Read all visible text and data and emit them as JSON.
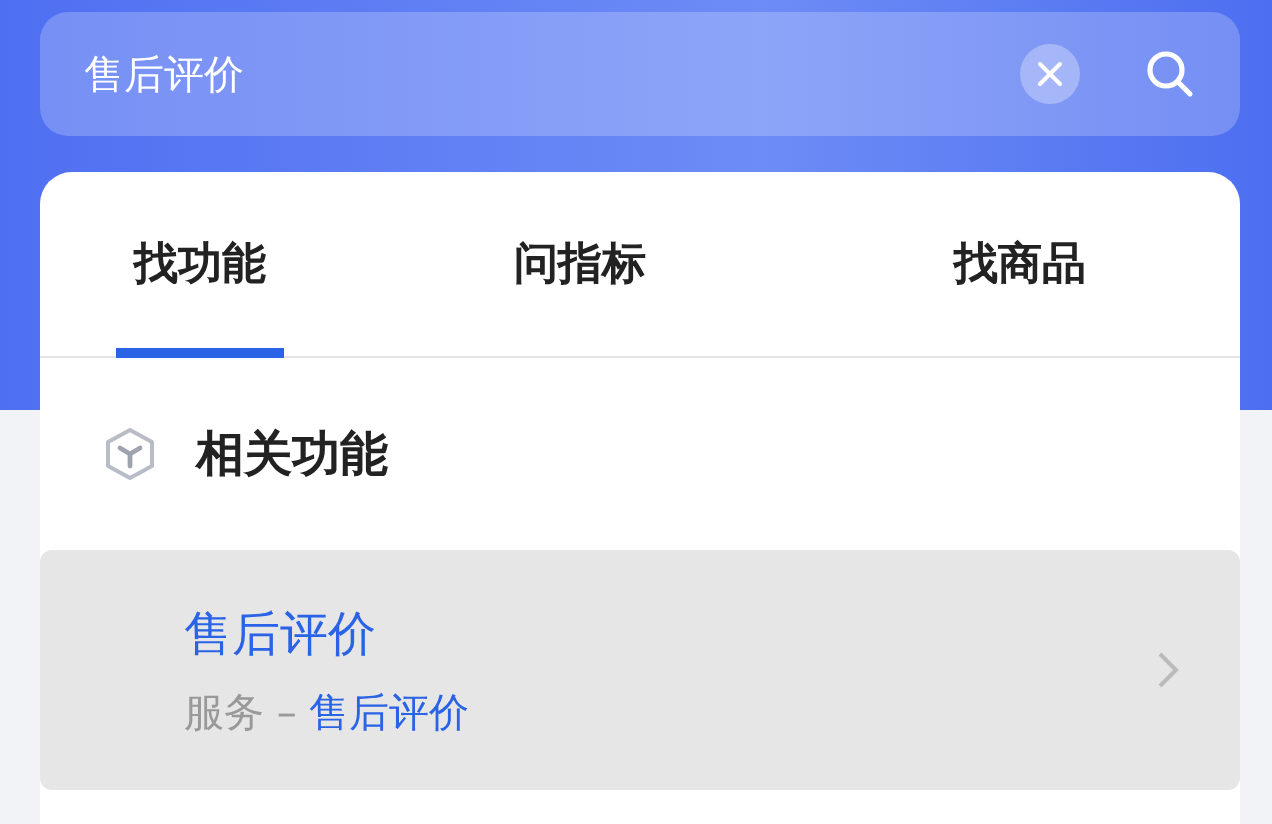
{
  "search": {
    "value": "售后评价"
  },
  "tabs": [
    {
      "label": "找功能",
      "selected": true
    },
    {
      "label": "问指标",
      "selected": false
    },
    {
      "label": "找商品",
      "selected": false
    }
  ],
  "section": {
    "title": "相关功能"
  },
  "results": [
    {
      "title": "售后评价",
      "category": "服务",
      "separator": "–",
      "target": "售后评价",
      "selected": true
    }
  ]
}
